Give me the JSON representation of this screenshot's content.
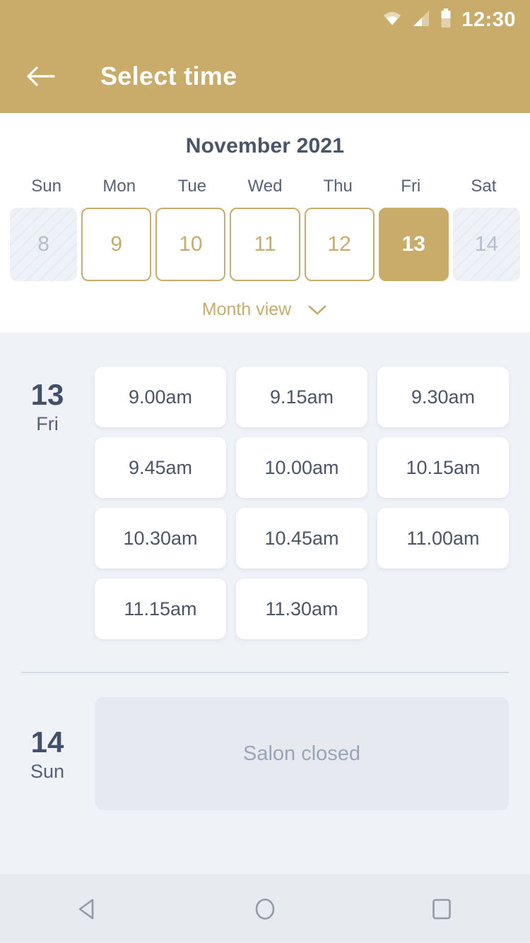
{
  "status_bar": {
    "time": "12:30",
    "icons": [
      "wifi-icon",
      "signal-icon",
      "battery-icon"
    ]
  },
  "app_bar": {
    "title": "Select time",
    "back_icon": "back-arrow-icon"
  },
  "calendar": {
    "month_label": "November 2021",
    "weekdays": [
      "Sun",
      "Mon",
      "Tue",
      "Wed",
      "Thu",
      "Fri",
      "Sat"
    ],
    "dates": [
      {
        "day": "8",
        "state": "disabled"
      },
      {
        "day": "9",
        "state": "available"
      },
      {
        "day": "10",
        "state": "available"
      },
      {
        "day": "11",
        "state": "available"
      },
      {
        "day": "12",
        "state": "available"
      },
      {
        "day": "13",
        "state": "selected"
      },
      {
        "day": "14",
        "state": "disabled"
      }
    ],
    "month_view_label": "Month view",
    "month_view_icon": "chevron-down-icon"
  },
  "schedule": {
    "days": [
      {
        "day_number": "13",
        "weekday": "Fri",
        "slots": [
          "9.00am",
          "9.15am",
          "9.30am",
          "9.45am",
          "10.00am",
          "10.15am",
          "10.30am",
          "10.45am",
          "11.00am",
          "11.15am",
          "11.30am"
        ]
      },
      {
        "day_number": "14",
        "weekday": "Sun",
        "closed_message": "Salon closed"
      }
    ]
  },
  "nav_bar": {
    "back_label": "back-triangle-icon",
    "home_label": "home-circle-icon",
    "recents_label": "recents-square-icon"
  },
  "colors": {
    "brand_gold": "#c9ac6a",
    "page_bg": "#eff2f7",
    "text_dark": "#4a5568",
    "muted": "#9aa5b8"
  }
}
